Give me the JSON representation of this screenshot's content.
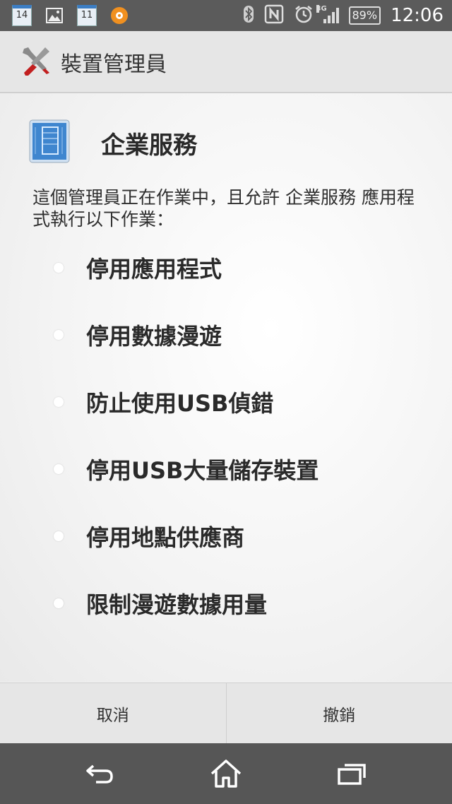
{
  "status_bar": {
    "icons": {
      "calendar_1_day": "14",
      "gallery": "image-icon",
      "calendar_2_day": "11",
      "app": "orange-circle-icon",
      "bluetooth": "bluetooth-icon",
      "nfc": "nfc-icon",
      "alarm": "alarm-icon",
      "network": "3G",
      "signal": "signal-icon"
    },
    "battery": "89%",
    "time": "12:06"
  },
  "action_bar": {
    "title": "裝置管理員",
    "icon": "wrench-screwdriver-icon"
  },
  "admin": {
    "icon": "blueprint-tablet-icon",
    "name": "企業服務",
    "description": "這個管理員正在作業中，且允許 企業服務 應用程式執行以下作業："
  },
  "permissions": [
    "停用應用程式",
    "停用數據漫遊",
    "防止使用USB偵錯",
    "停用USB大量儲存裝置",
    "停用地點供應商",
    "限制漫遊數據用量"
  ],
  "buttons": {
    "cancel": "取消",
    "revoke": "撤銷"
  },
  "nav": {
    "back": "back-icon",
    "home": "home-icon",
    "recents": "recents-icon"
  },
  "colors": {
    "status_bar": "#5b5b5b",
    "nav_bar": "#565656",
    "action_bar": "#e6e6e6",
    "accent": "#3b7dc4"
  }
}
